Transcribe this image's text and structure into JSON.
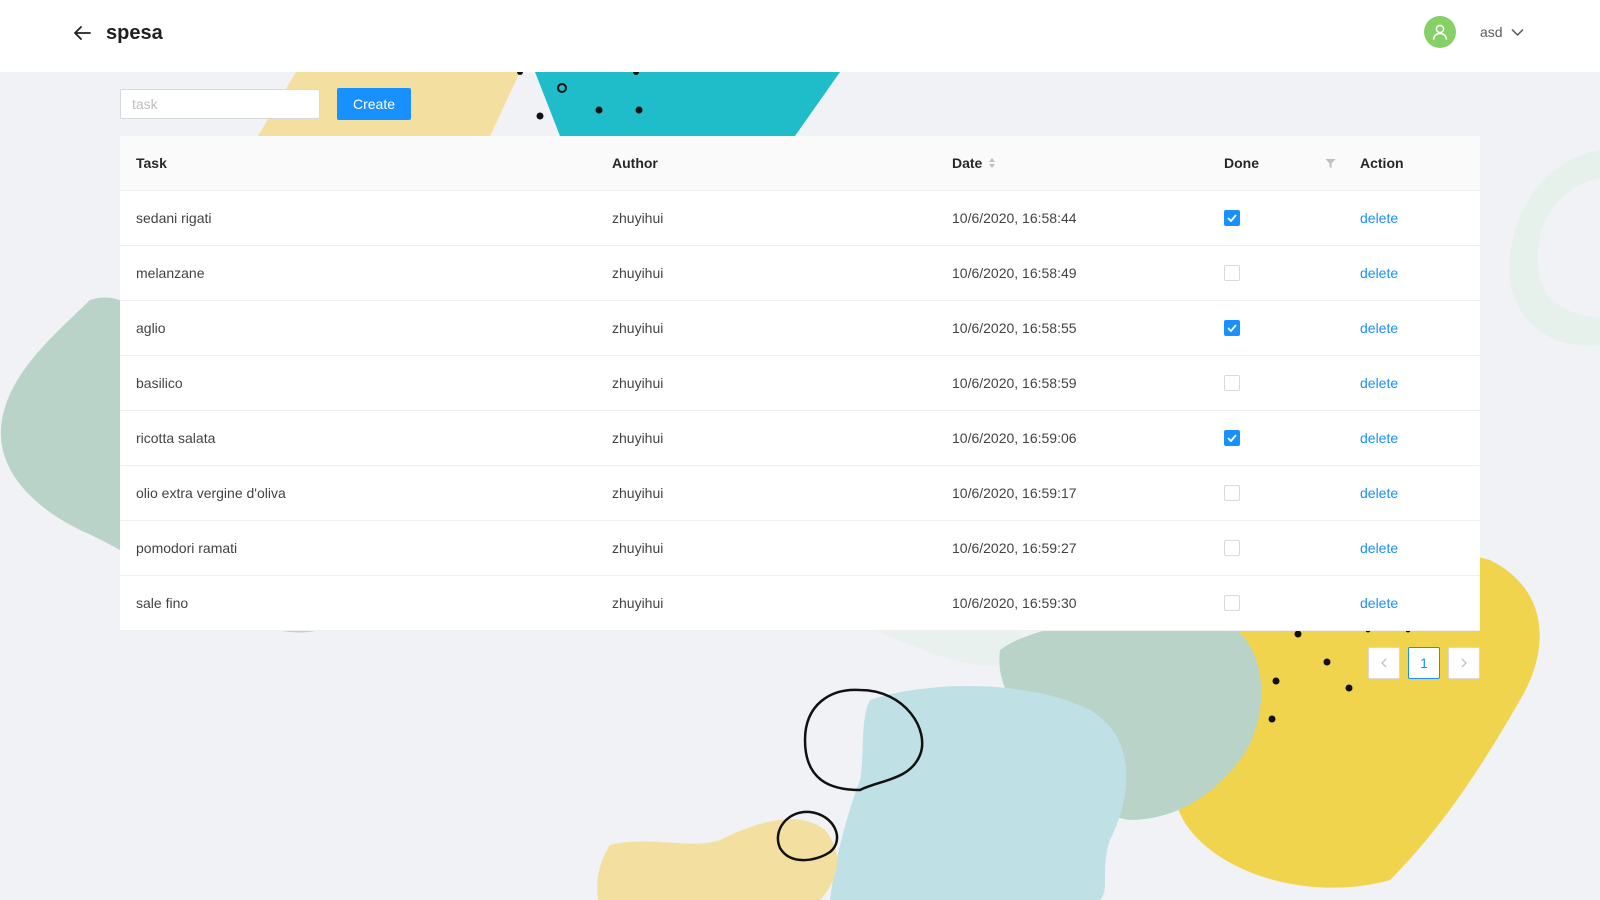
{
  "header": {
    "title": "spesa",
    "username": "asd"
  },
  "toolbar": {
    "input_value": "",
    "input_placeholder": "task",
    "create_label": "Create"
  },
  "table": {
    "columns": {
      "task": "Task",
      "author": "Author",
      "date": "Date",
      "done": "Done",
      "action": "Action"
    },
    "rows": [
      {
        "task": "sedani rigati",
        "author": "zhuyihui",
        "date": "10/6/2020, 16:58:44",
        "done": true,
        "action": "delete"
      },
      {
        "task": "melanzane",
        "author": "zhuyihui",
        "date": "10/6/2020, 16:58:49",
        "done": false,
        "action": "delete"
      },
      {
        "task": "aglio",
        "author": "zhuyihui",
        "date": "10/6/2020, 16:58:55",
        "done": true,
        "action": "delete"
      },
      {
        "task": "basilico",
        "author": "zhuyihui",
        "date": "10/6/2020, 16:58:59",
        "done": false,
        "action": "delete"
      },
      {
        "task": "ricotta salata",
        "author": "zhuyihui",
        "date": "10/6/2020, 16:59:06",
        "done": true,
        "action": "delete"
      },
      {
        "task": "olio extra vergine d'oliva",
        "author": "zhuyihui",
        "date": "10/6/2020, 16:59:17",
        "done": false,
        "action": "delete"
      },
      {
        "task": "pomodori ramati",
        "author": "zhuyihui",
        "date": "10/6/2020, 16:59:27",
        "done": false,
        "action": "delete"
      },
      {
        "task": "sale fino",
        "author": "zhuyihui",
        "date": "10/6/2020, 16:59:30",
        "done": false,
        "action": "delete"
      }
    ]
  },
  "pagination": {
    "current_page": "1"
  },
  "icons": {
    "back": "arrow-left-icon",
    "avatar": "user-icon",
    "user_menu": "chevron-down-icon",
    "sort": "sort-icon",
    "filter": "filter-icon",
    "prev": "chevron-left-icon",
    "next": "chevron-right-icon"
  },
  "colors": {
    "primary": "#1890ff",
    "avatar_bg": "#87d068",
    "page_bg": "#f0f2f5"
  }
}
